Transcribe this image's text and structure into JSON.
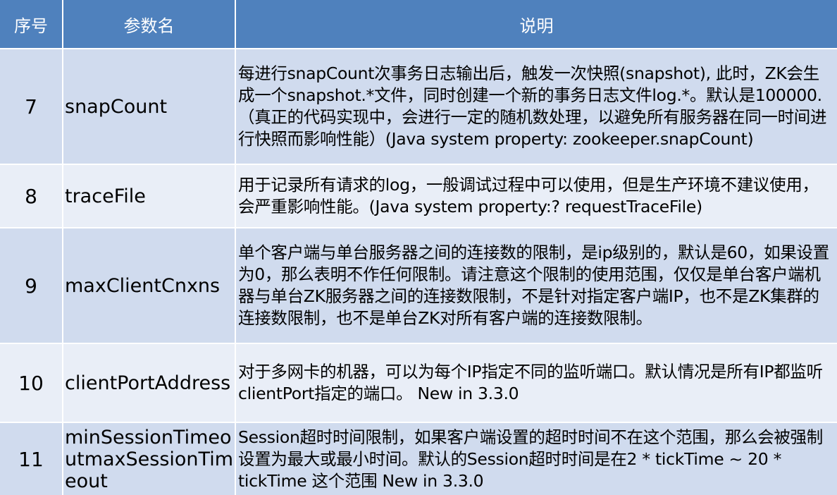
{
  "table": {
    "headers": [
      "序号",
      "参数名",
      "说明"
    ],
    "rows": [
      {
        "num": "7",
        "name": "snapCount",
        "desc": "每进行snapCount次事务日志输出后，触发一次快照(snapshot), 此时，ZK会生成一个snapshot.*文件，同时创建一个新的事务日志文件log.*。默认是100000.（真正的代码实现中，会进行一定的随机数处理，以避免所有服务器在同一时间进行快照而影响性能）(Java system property: zookeeper.snapCount)"
      },
      {
        "num": "8",
        "name": "traceFile",
        "desc": "用于记录所有请求的log，一般调试过程中可以使用，但是生产环境不建议使用，会严重影响性能。(Java system property:? requestTraceFile)"
      },
      {
        "num": "9",
        "name": "maxClientCnxns",
        "desc": "单个客户端与单台服务器之间的连接数的限制，是ip级别的，默认是60，如果设置为0，那么表明不作任何限制。请注意这个限制的使用范围，仅仅是单台客户端机器与单台ZK服务器之间的连接数限制，不是针对指定客户端IP，也不是ZK集群的连接数限制，也不是单台ZK对所有客户端的连接数限制。"
      },
      {
        "num": "10",
        "name": "clientPortAddress",
        "desc": "对于多网卡的机器，可以为每个IP指定不同的监听端口。默认情况是所有IP都监听 clientPort指定的端口。 New in 3.3.0"
      },
      {
        "num": "11",
        "name": "minSessionTimeoutmaxSessionTimeout",
        "desc": "Session超时时间限制，如果客户端设置的超时时间不在这个范围，那么会被强制设置为最大或最小时间。默认的Session超时时间是在2 * tickTime ~ 20 * tickTime 这个范围 New in 3.3.0"
      }
    ]
  }
}
